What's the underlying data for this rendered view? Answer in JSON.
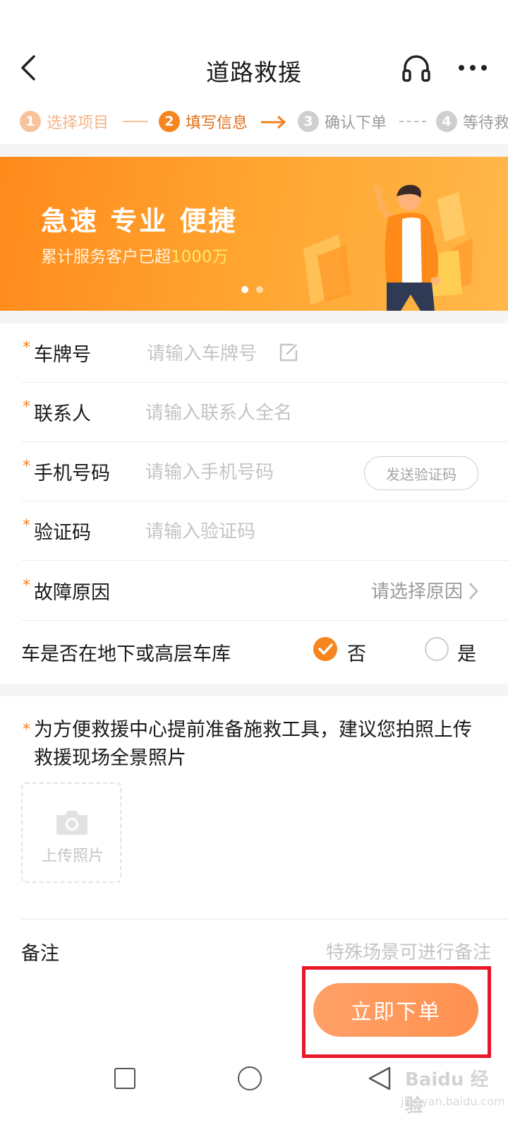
{
  "header": {
    "title": "道路救援"
  },
  "steps": [
    {
      "num": "1",
      "label": "选择项目",
      "state": "done"
    },
    {
      "num": "2",
      "label": "填写信息",
      "state": "active"
    },
    {
      "num": "3",
      "label": "确认下单",
      "state": "todo"
    },
    {
      "num": "4",
      "label": "等待救",
      "state": "todo"
    }
  ],
  "banner": {
    "title": "急速 专业 便捷",
    "subtitle_prefix": "累计服务客户已超",
    "subtitle_highlight": "1000万",
    "slide_count": 2,
    "active_slide": 1
  },
  "form": {
    "plate": {
      "label": "车牌号",
      "placeholder": "请输入车牌号",
      "required": true
    },
    "contact": {
      "label": "联系人",
      "placeholder": "请输入联系人全名",
      "required": true
    },
    "phone": {
      "label": "手机号码",
      "placeholder": "请输入手机号码",
      "required": true,
      "send_code_label": "发送验证码"
    },
    "code": {
      "label": "验证码",
      "placeholder": "请输入验证码",
      "required": true
    },
    "fault": {
      "label": "故障原因",
      "value": "请选择原因",
      "required": true
    },
    "underground": {
      "question": "车是否在地下或高层车库",
      "option_no": "否",
      "option_yes": "是",
      "selected": "否"
    }
  },
  "photo": {
    "required_mark": "*",
    "note": "为方便救援中心提前准备施救工具，建议您拍照上传救援现场全景照片",
    "upload_label": "上传照片"
  },
  "remark": {
    "label": "备注",
    "placeholder": "特殊场景可进行备注"
  },
  "submit": {
    "label": "立即下单"
  },
  "required_mark": "*",
  "watermark": {
    "text": "Baidu 经验",
    "sub": "jingyan.baidu.com"
  },
  "colors": {
    "accent": "#f6851f",
    "highlight_box": "#e8172a",
    "submit_bg": "#ff9a5e"
  }
}
